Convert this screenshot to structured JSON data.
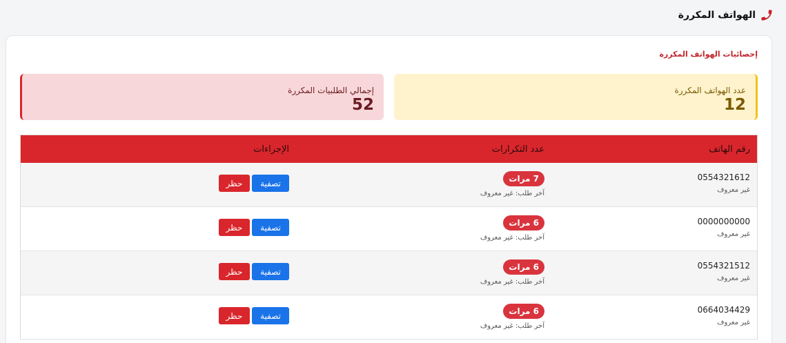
{
  "header": {
    "title": "الهواتف المكررة",
    "icon": "phone-icon"
  },
  "section_title": "إحصائيات الهواتف المكررة",
  "stats": {
    "phones": {
      "label": "عدد الهواتف المكررة",
      "value": "12"
    },
    "orders": {
      "label": "إجمالي الطلبيات المكررة",
      "value": "52"
    }
  },
  "table": {
    "headers": {
      "phone": "رقم الهاتف",
      "count": "عدد التكرارات",
      "actions": "الإجراءات"
    },
    "rows": [
      {
        "phone": "0554321612",
        "name": "غير معروف",
        "count": "7 مرات",
        "last": "آخر طلب: غير معروف",
        "clear": "تصفية",
        "block": "حظر"
      },
      {
        "phone": "0000000000",
        "name": "غير معروف",
        "count": "6 مرات",
        "last": "آخر طلب: غير معروف",
        "clear": "تصفية",
        "block": "حظر"
      },
      {
        "phone": "0554321512",
        "name": "غير معروف",
        "count": "6 مرات",
        "last": "آخر طلب: غير معروف",
        "clear": "تصفية",
        "block": "حظر"
      },
      {
        "phone": "0664034429",
        "name": "غير معروف",
        "count": "6 مرات",
        "last": "آخر طلب: غير معروف",
        "clear": "تصفية",
        "block": "حظر"
      }
    ]
  },
  "colors": {
    "primary_red": "#d9262c",
    "blue": "#1a73e8",
    "warning_bg": "#fff3cd",
    "danger_bg": "#f8d7da"
  }
}
